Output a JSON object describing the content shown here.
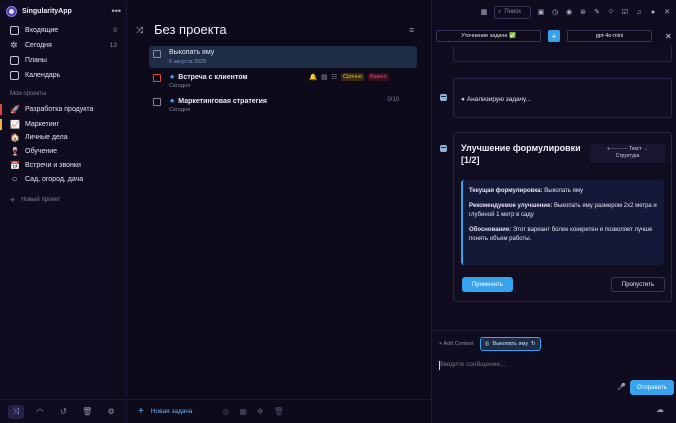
{
  "app": {
    "name": "SingularityApp",
    "menu_icon": "more-dots-icon"
  },
  "sidebar": {
    "nav": [
      {
        "label": "Входящие",
        "count": "0",
        "icon": "inbox-icon"
      },
      {
        "label": "Сегодня",
        "count": "13",
        "icon": "star-icon"
      },
      {
        "label": "Планы",
        "count": "",
        "icon": "calendar-plans-icon"
      },
      {
        "label": "Календарь",
        "count": "",
        "icon": "calendar-icon"
      }
    ],
    "projects_label": "Мои проекты",
    "projects": [
      {
        "label": "Разработка продукта",
        "icon": "🚀",
        "color": "#e0443f"
      },
      {
        "label": "Маркетинг",
        "icon": "📈",
        "color": "#f0b52a"
      },
      {
        "label": "Личные дела",
        "icon": "🏠",
        "color": ""
      },
      {
        "label": "Обучение",
        "icon": "🍷",
        "color": ""
      },
      {
        "label": "Встречи и звонки",
        "icon": "📅",
        "color": ""
      },
      {
        "label": "Сад, огород, дача",
        "icon": "○",
        "color": ""
      }
    ],
    "new_project": "Новый проект"
  },
  "middle": {
    "title": "Без проекта",
    "tasks": [
      {
        "title": "Выкопать яму",
        "sub": "6 августа 2025",
        "selected": true,
        "starred": false
      },
      {
        "title": "Встреча с клиентом",
        "sub": "Сегодня",
        "selected": false,
        "starred": true,
        "badges": [
          "Срочно",
          "Важно"
        ]
      },
      {
        "title": "Маркетинговая стратегия",
        "sub": "Сегодня",
        "selected": false,
        "starred": true,
        "count": "0/10"
      }
    ],
    "new_task": "Новая задача"
  },
  "topbar": {
    "search_placeholder": "Поиск"
  },
  "ai": {
    "mode": "Уточнение задачи ✅",
    "model": "gpt-4o-mini",
    "analyzing": "Анализирую задачу...",
    "improve_title": "Улучшение формулировки [1/2]",
    "diagram_line1": "Текст →",
    "diagram_line2": "Структура",
    "current_label": "Текущая формулировка:",
    "current_value": "Выкопать яму",
    "recommended_label": "Рекомендуемое улучшение:",
    "recommended_value": "Выкопать яму размером 2x2 метра и глубиной 1 метр в саду",
    "reason_label": "Обоснование:",
    "reason_value": "Этот вариант более конкретен и позволяет лучше понять объем работы.",
    "apply": "Применить",
    "skip": "Пропустить",
    "add_context": "+ Add Context",
    "context_chip": "Выкопать яму",
    "message_placeholder": "Введите сообщение...",
    "send": "Отправить"
  },
  "colors": {
    "accent": "#37a3ee",
    "background": "#0d0a1a",
    "urgent": "#f0b52a",
    "important": "#e8476f"
  }
}
